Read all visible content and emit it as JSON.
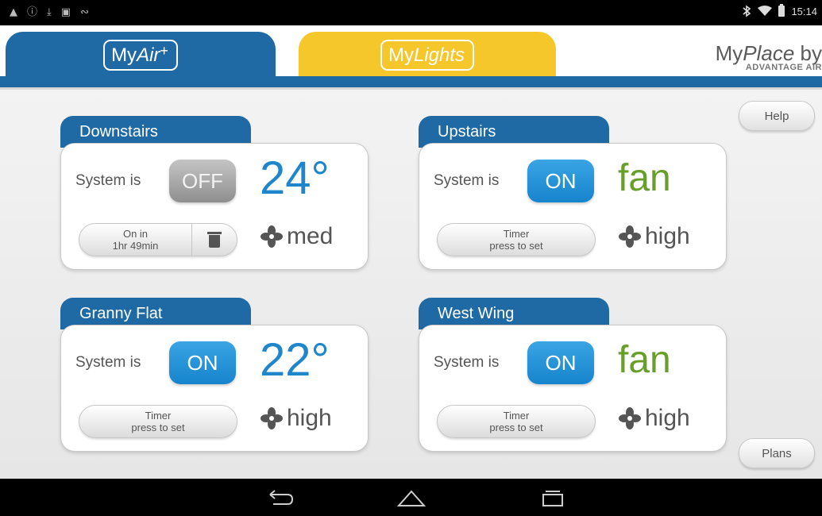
{
  "status": {
    "time": "15:14",
    "icons": [
      "person-icon",
      "alert-icon",
      "download-icon",
      "image-icon",
      "usb-icon"
    ],
    "right_icons": [
      "bluetooth-icon",
      "wifi-icon",
      "battery-icon"
    ]
  },
  "header": {
    "tab_air": {
      "prefix": "My",
      "name": "Air",
      "suffix": "+"
    },
    "tab_lights": {
      "prefix": "My",
      "name": "Lights"
    },
    "brand_my": "My",
    "brand_place": "Place",
    "brand_by": " by",
    "brand_sub": "ADVANTAGE AIR"
  },
  "buttons": {
    "help": "Help",
    "plans": "Plans"
  },
  "colors": {
    "primary_blue": "#1f6aa4",
    "lights_yellow": "#f6c72b",
    "on_blue": "#1684cc",
    "temp_blue": "#1f86cc",
    "fan_green": "#6a9e2a"
  },
  "zones": [
    {
      "name": "Downstairs",
      "system_label": "System is",
      "power": "OFF",
      "display": "24°",
      "timer_line1": "On in",
      "timer_line2": "1hr 49min",
      "fan_speed": "med"
    },
    {
      "name": "Upstairs",
      "system_label": "System is",
      "power": "ON",
      "display": "fan",
      "timer_line1": "Timer",
      "timer_line2": "press to set",
      "fan_speed": "high"
    },
    {
      "name": "Granny Flat",
      "system_label": "System is",
      "power": "ON",
      "display": "22°",
      "timer_line1": "Timer",
      "timer_line2": "press to set",
      "fan_speed": "high"
    },
    {
      "name": "West Wing",
      "system_label": "System is",
      "power": "ON",
      "display": "fan",
      "timer_line1": "Timer",
      "timer_line2": "press to set",
      "fan_speed": "high"
    }
  ],
  "navbar": [
    "back-icon",
    "home-icon",
    "recents-icon"
  ]
}
